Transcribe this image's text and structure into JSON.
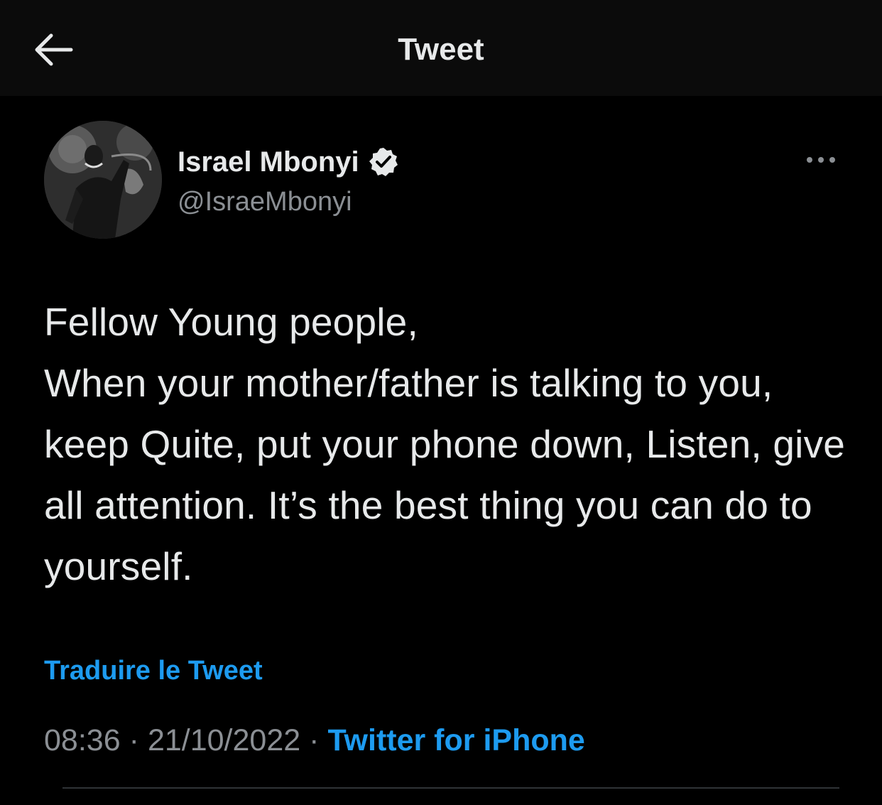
{
  "header": {
    "title": "Tweet",
    "back_icon": "arrow-left-icon"
  },
  "author": {
    "name": "Israel Mbonyi",
    "handle": "@IsraeMbonyi",
    "verified": true,
    "verified_icon": "verified-badge-icon",
    "avatar_icon": "profile-photo"
  },
  "more_icon": "ellipsis-icon",
  "tweet": {
    "text": "Fellow Young people,\nWhen your mother/father is talking to you, keep Quite, put your phone down, Listen, give all attention. It’s the best thing you can do to yourself.",
    "translate_label": "Traduire le Tweet",
    "time": "08:36",
    "date": "21/10/2022",
    "separator": "·",
    "source": "Twitter for iPhone"
  },
  "colors": {
    "background": "#000000",
    "header_background": "#0b0b0b",
    "text": "#e7e9ea",
    "secondary_text": "#8b8f94",
    "accent": "#1d9bf0",
    "divider": "#2f3336"
  }
}
